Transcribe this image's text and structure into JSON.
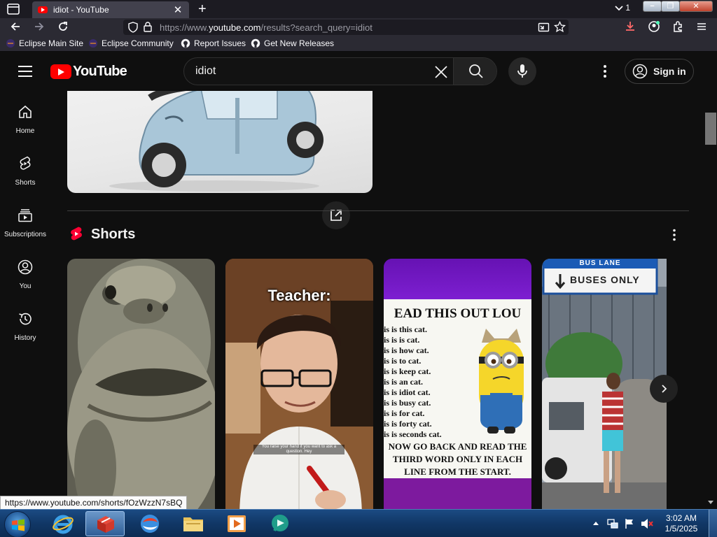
{
  "browser": {
    "tab_title": "idiot - YouTube",
    "tab_count": "1",
    "url_prefix": "https://www.",
    "url_domain": "youtube.com",
    "url_path": "/results?search_query=idiot",
    "bookmarks": [
      "Eclipse Main Site",
      "Eclipse Community",
      "Report Issues",
      "Get New Releases"
    ]
  },
  "youtube": {
    "logo_text": "YouTube",
    "search_value": "idiot",
    "sign_in_label": "Sign in",
    "sidebar": [
      {
        "label": "Home",
        "icon": "home-icon"
      },
      {
        "label": "Shorts",
        "icon": "shorts-icon"
      },
      {
        "label": "Subscriptions",
        "icon": "subscriptions-icon"
      },
      {
        "label": "You",
        "icon": "you-icon"
      },
      {
        "label": "History",
        "icon": "history-icon"
      }
    ],
    "shorts_title": "Shorts",
    "shorts": [
      {
        "overlay": ""
      },
      {
        "overlay": "Teacher:",
        "caption": "You raise your hand if you want to ask a question. Hey"
      },
      {
        "overlay": "EAD THIS OUT LOU",
        "lines": [
          "is is this cat.",
          "is is is cat.",
          "is is how cat.",
          "is is to cat.",
          "is is keep cat.",
          "is is an cat.",
          "is is idiot cat.",
          "is is busy cat.",
          "is is for cat.",
          "is is forty cat.",
          "is is seconds cat."
        ],
        "footer": "NOW GO BACK AND READ THE THIRD WORD ONLY IN EACH LINE FROM THE START."
      },
      {
        "sign_top": "BUS LANE",
        "sign_main": "BUSES ONLY"
      }
    ],
    "status_link": "https://www.youtube.com/shorts/fOzWzzN7sBQ"
  },
  "taskbar": {
    "time": "3:02 AM",
    "date": "1/5/2025"
  }
}
